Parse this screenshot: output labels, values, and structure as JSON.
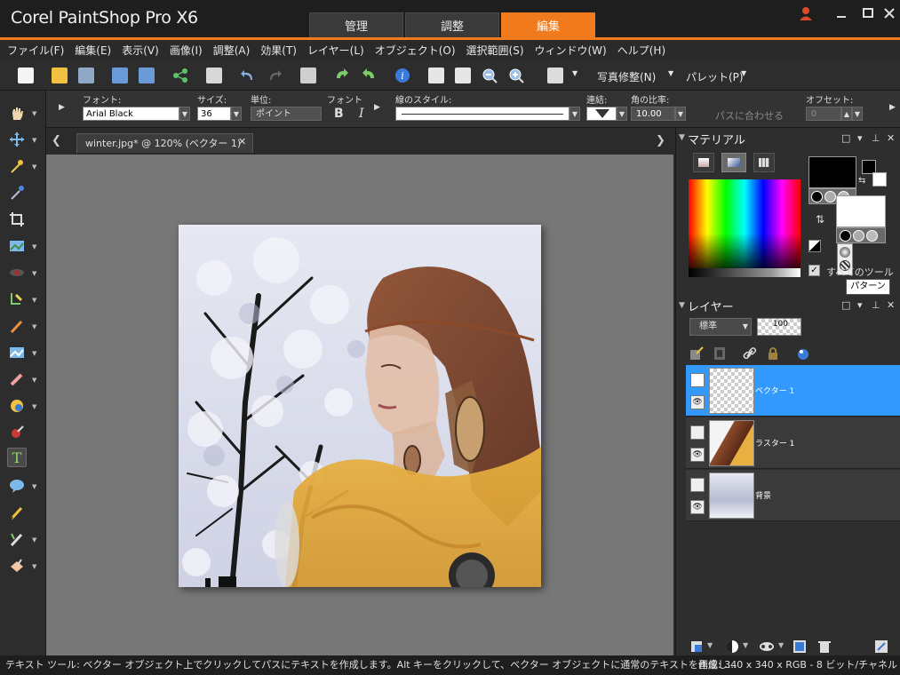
{
  "app": {
    "title": "Corel PaintShop Pro X6",
    "workspace_tabs": [
      {
        "label": "管理",
        "active": false
      },
      {
        "label": "調整",
        "active": false
      },
      {
        "label": "編集",
        "active": true
      }
    ]
  },
  "menu": [
    "ファイル(F)",
    "編集(E)",
    "表示(V)",
    "画像(I)",
    "調整(A)",
    "効果(T)",
    "レイヤー(L)",
    "オブジェクト(O)",
    "選択範囲(S)",
    "ウィンドウ(W)",
    "ヘルプ(H)"
  ],
  "toolbar": {
    "photo_fix_label": "写真修整(N)",
    "palette_label": "パレット(P)"
  },
  "tool_options": {
    "font_label": "フォント:",
    "font_value": "Arial Black",
    "size_label": "サイズ:",
    "size_value": "36",
    "unit_label": "単位:",
    "unit_value": "ポイント",
    "font_style_label": "フォント",
    "bold_glyph": "B",
    "italic_glyph": "I",
    "line_style_label": "線のスタイル:",
    "join_label": "連結:",
    "miter_label": "角の比率:",
    "miter_value": "10.00",
    "fit_path_label": "パスに合わせる",
    "offset_label": "オフセット:",
    "offset_value": "0"
  },
  "document": {
    "tab_label": "winter.jpg* @ 120% (ベクター 1)"
  },
  "materials": {
    "title": "マテリアル",
    "all_tools_label": "すべてのツール",
    "tooltip": "パターン"
  },
  "layers": {
    "title": "レイヤー",
    "blend_mode": "標準",
    "opacity": "100",
    "items": [
      {
        "name": "ベクター 1",
        "selected": true
      },
      {
        "name": "ラスター 1",
        "selected": false
      },
      {
        "name": "背景",
        "selected": false
      }
    ]
  },
  "status": {
    "hint": "テキスト ツール: ベクター オブジェクト上でクリックしてパスにテキストを作成します。Alt キーをクリックして、ベクター オブジェクトに通常のテキストを作成し...",
    "image_info": "画像: 340 x 340 x RGB - 8 ビット/チャネル"
  },
  "colors": {
    "accent": "#f07a1c",
    "selected_layer": "#3399ff",
    "canvas_bg": "#777777"
  }
}
